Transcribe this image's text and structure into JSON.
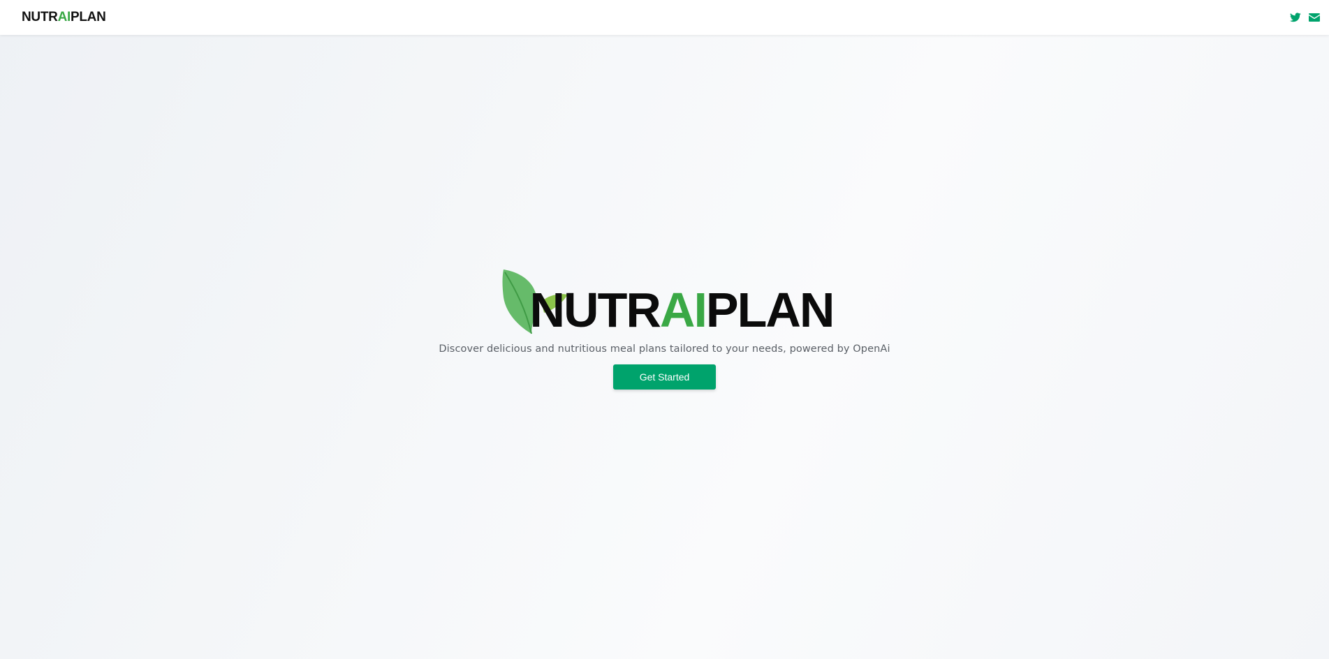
{
  "navbar": {
    "logo": {
      "part1": "NUTR",
      "part2": "AI",
      "part3": "PLAN"
    },
    "icons": [
      "twitter-icon",
      "mail-icon"
    ]
  },
  "hero": {
    "logo": {
      "part1": "NUTR",
      "part2": "AI",
      "part3": "PLAN"
    },
    "tagline": "Discover delicious and nutritious meal plans tailored to your needs, powered by OpenAi",
    "cta_label": "Get Started"
  },
  "colors": {
    "brand_green": "#3aa845",
    "button_green": "#00a36c",
    "icon_green": "#00a36c",
    "text_dark": "#0b0b0b"
  }
}
